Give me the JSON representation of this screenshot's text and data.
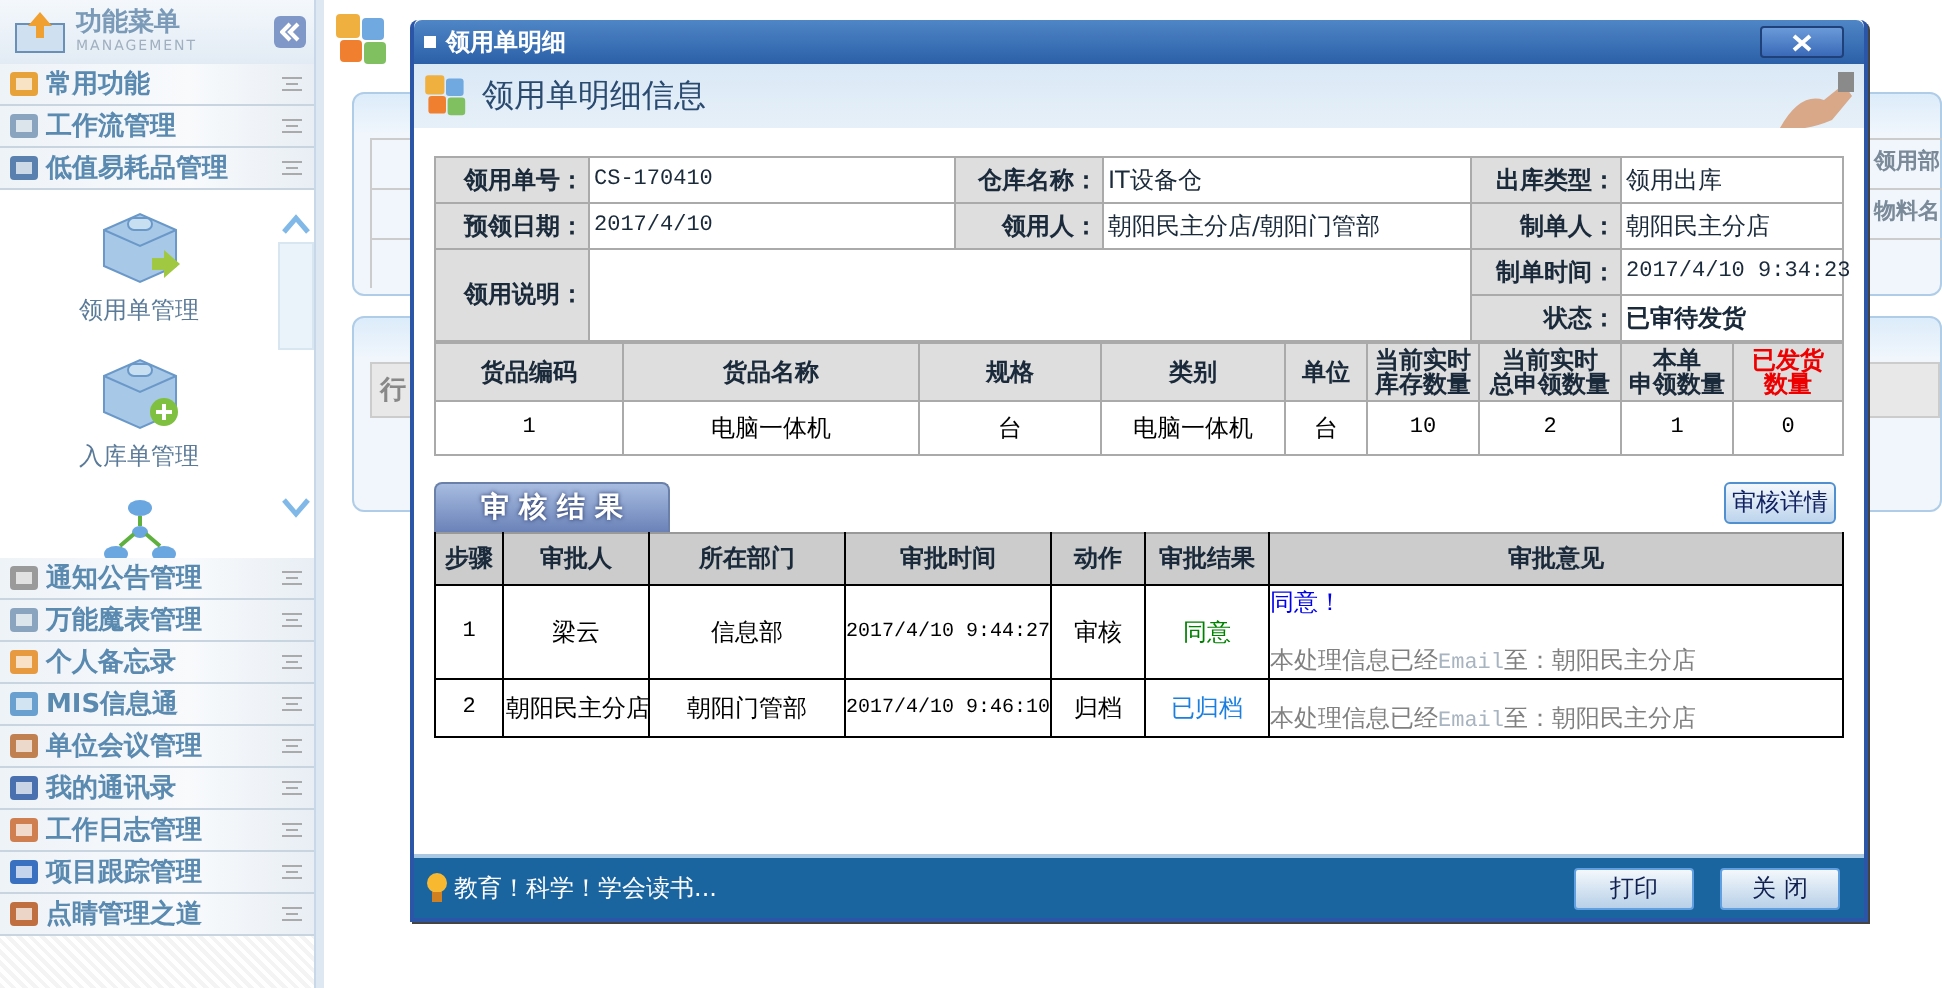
{
  "sidebar": {
    "title": "功能菜单",
    "subtitle": "MANAGEMENT",
    "top_items": [
      {
        "label": "常用功能",
        "expanded": false
      },
      {
        "label": "工作流管理",
        "expanded": false
      },
      {
        "label": "低值易耗品管理",
        "expanded": true
      }
    ],
    "sub_items": [
      {
        "kind": "arrow",
        "label": "领用单管理"
      },
      {
        "kind": "plus",
        "label": "入库单管理"
      },
      {
        "kind": "network"
      }
    ],
    "bottom_items": [
      {
        "label": "通知公告管理"
      },
      {
        "label": "万能魔表管理"
      },
      {
        "label": "个人备忘录"
      },
      {
        "label": "MIS信息通"
      },
      {
        "label": "单位会议管理"
      },
      {
        "label": "我的通讯录"
      },
      {
        "label": "工作日志管理"
      },
      {
        "label": "项目跟踪管理"
      },
      {
        "label": "点睛管理之道"
      }
    ]
  },
  "background": {
    "left_text": "行",
    "right_texts": [
      "领用部",
      "物料名"
    ]
  },
  "dialog": {
    "title": "领用单明细",
    "heading": "领用单明细信息",
    "info": [
      {
        "label": "领用单号：",
        "value": "CS-170410",
        "kind": "code"
      },
      {
        "label": "仓库名称：",
        "value": "IT设备仓",
        "kind": "text"
      },
      {
        "label": "出库类型：",
        "value": "领用出库",
        "kind": "text"
      },
      {
        "label": "预领日期：",
        "value": "2017/4/10",
        "kind": "code"
      },
      {
        "label": "领用人：",
        "value": "朝阳民主分店/朝阳门管部",
        "kind": "text"
      },
      {
        "label": "制单人：",
        "value": "朝阳民主分店",
        "kind": "text"
      }
    ],
    "note_label": "领用说明：",
    "extra_info": [
      {
        "label": "制单时间：",
        "value": "2017/4/10 9:34:23",
        "kind": "code"
      },
      {
        "label": "状态：",
        "value": "已审待发货",
        "kind": "status"
      }
    ],
    "items_table": {
      "columns": [
        {
          "lines": [
            "货品编码"
          ],
          "alert": false
        },
        {
          "lines": [
            "货品名称"
          ],
          "alert": false
        },
        {
          "lines": [
            "规格"
          ],
          "alert": false
        },
        {
          "lines": [
            "类别"
          ],
          "alert": false
        },
        {
          "lines": [
            "单位"
          ],
          "alert": false
        },
        {
          "lines": [
            "当前实时",
            "库存数量"
          ],
          "alert": false
        },
        {
          "lines": [
            "当前实时",
            "总申领数量"
          ],
          "alert": false
        },
        {
          "lines": [
            "本单",
            "申领数量"
          ],
          "alert": false
        },
        {
          "lines": [
            "已发货",
            "数量"
          ],
          "alert": true
        }
      ],
      "rows": [
        [
          "1",
          "电脑一体机",
          "台",
          "电脑一体机",
          "台",
          "10",
          "2",
          "1",
          "0"
        ]
      ]
    },
    "audit_tab": "审 核 结 果",
    "detail_button": "审核详情",
    "audit_table": {
      "columns": [
        "步骤",
        "审批人",
        "所在部门",
        "审批时间",
        "动作",
        "审批结果",
        "审批意见"
      ],
      "rows": [
        {
          "step": "1",
          "approver": "梁云",
          "department": "信息部",
          "time": "2017/4/10 9:44:27",
          "action": "审核",
          "result": "同意",
          "color": "#008000",
          "comment": "同意！",
          "notice_before": "本处理信息已经",
          "notice_email": "Email",
          "notice_after": "至：朝阳民主分店"
        },
        {
          "step": "2",
          "approver": "朝阳民主分店",
          "department": "朝阳门管部",
          "time": "2017/4/10 9:46:10",
          "action": "归档",
          "result": "已归档",
          "color": "#1a7fe0",
          "notice_before": "本处理信息已经",
          "notice_email": "Email",
          "notice_after": "至：朝阳民主分店"
        }
      ]
    },
    "tip": "教育！科学！学会读书...",
    "buttons": [
      "打印",
      "关 闭"
    ]
  }
}
